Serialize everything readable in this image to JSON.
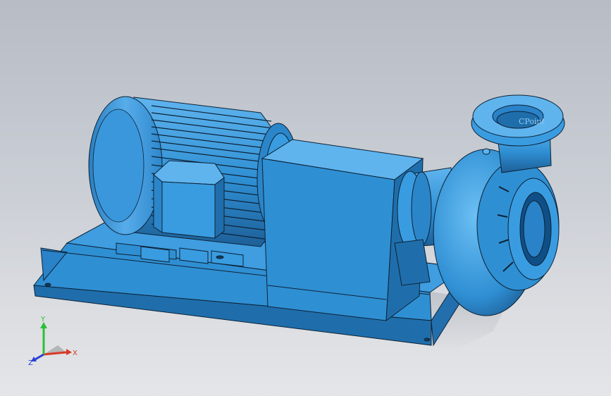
{
  "viewport": {
    "emboss_text": "CPoint",
    "colors": {
      "background_top": "#b7bcc5",
      "background_bottom": "#e4e5e8",
      "model_base": "#2f8fd3",
      "model_light": "#5fb4ee",
      "model_dark": "#1d5f97",
      "edge": "#0d2236"
    }
  },
  "triad": {
    "x_label": "X",
    "y_label": "Y",
    "z_label": "Z",
    "x_color": "#d83a2a",
    "y_color": "#2dbf3a",
    "z_color": "#2a3fd8"
  }
}
